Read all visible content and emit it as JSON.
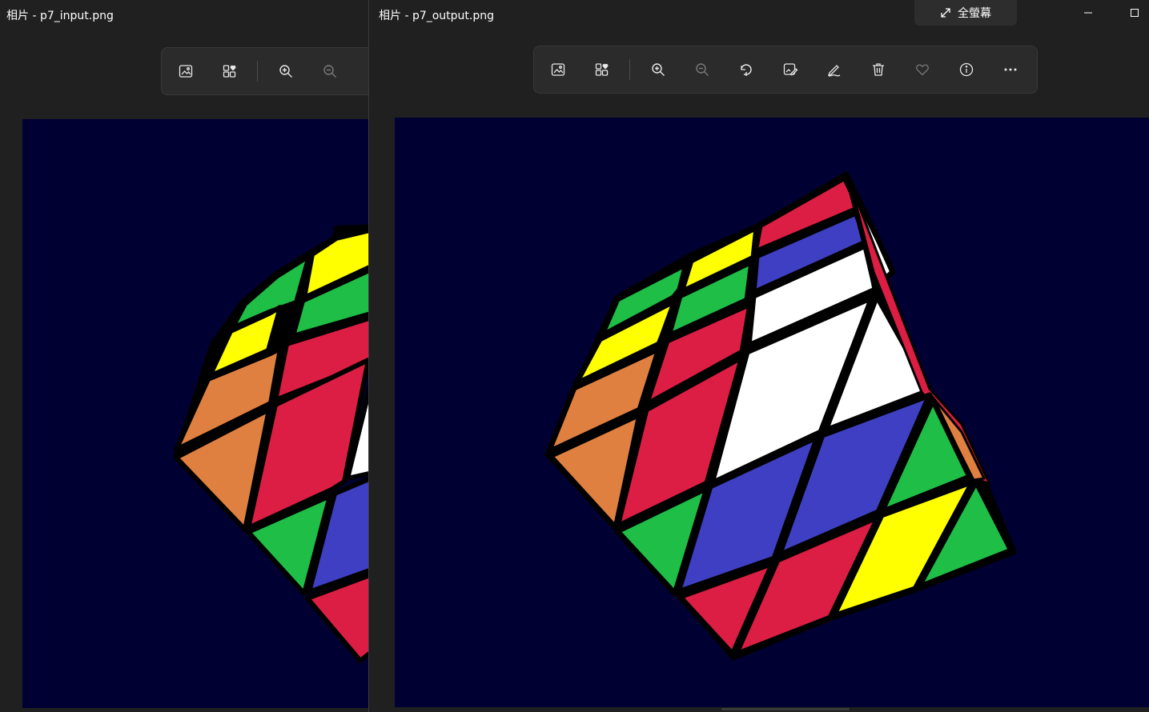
{
  "left_window": {
    "title": "相片 - p7_input.png",
    "toolbar": [
      {
        "name": "view-image-button",
        "icon": "image-icon"
      },
      {
        "name": "collection-button",
        "icon": "collection-heart-icon"
      },
      {
        "name": "zoom-in-button",
        "icon": "zoom-in-icon"
      },
      {
        "name": "zoom-out-button",
        "icon": "zoom-out-icon",
        "disabled": true
      }
    ]
  },
  "right_window": {
    "title": "相片 - p7_output.png",
    "fullscreen_label": "全螢幕",
    "toolbar": [
      {
        "name": "view-image-button",
        "icon": "image-icon"
      },
      {
        "name": "collection-button",
        "icon": "collection-heart-icon"
      },
      {
        "name": "zoom-in-button",
        "icon": "zoom-in-icon"
      },
      {
        "name": "zoom-out-button",
        "icon": "zoom-out-icon",
        "disabled": true
      },
      {
        "name": "rotate-button",
        "icon": "rotate-icon"
      },
      {
        "name": "edit-image-button",
        "icon": "edit-image-icon"
      },
      {
        "name": "draw-button",
        "icon": "pen-icon"
      },
      {
        "name": "delete-button",
        "icon": "trash-icon"
      },
      {
        "name": "favorite-button",
        "icon": "heart-icon",
        "disabled": true
      },
      {
        "name": "info-button",
        "icon": "info-icon"
      },
      {
        "name": "more-button",
        "icon": "more-icon"
      }
    ]
  },
  "colors": {
    "window_bg": "#202020",
    "toolbar_bg": "#2b2b2b",
    "canvas_bg": "#000033",
    "cube_red": "#dc1e44",
    "cube_blue": "#3f3fc4",
    "cube_white": "#ffffff",
    "cube_yellow": "#ffff00",
    "cube_green": "#1fbe46",
    "cube_orange": "#e08040"
  }
}
